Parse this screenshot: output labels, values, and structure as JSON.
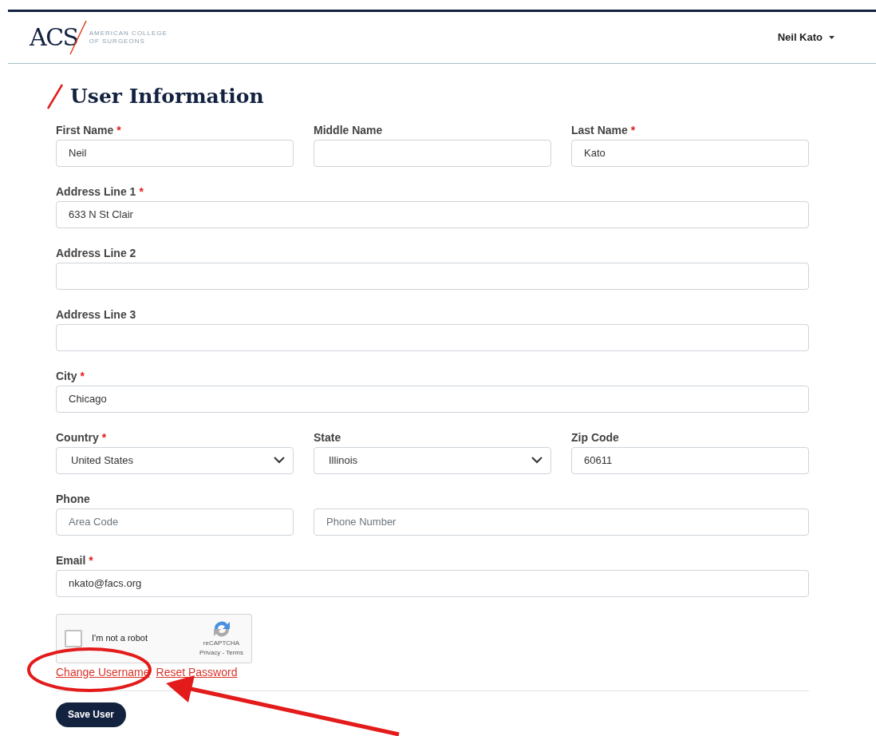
{
  "header": {
    "logo_mark": "ACS",
    "logo_text": [
      "AMERICAN COLLEGE",
      "OF SURGEONS"
    ],
    "user_menu": "Neil Kato"
  },
  "page_title": "User Information",
  "rows": [
    {
      "fields": [
        {
          "label": "First Name",
          "required_mark": "*",
          "kind": "text",
          "value": "Neil"
        },
        {
          "label": "Middle Name",
          "kind": "text"
        },
        {
          "label": "Last Name",
          "required_mark": "*",
          "kind": "text",
          "value": "Kato"
        }
      ]
    },
    {
      "fields": [
        {
          "label": "Address Line 1",
          "required_mark": "*",
          "kind": "text",
          "value": "633 N St Clair"
        }
      ]
    },
    {
      "fields": [
        {
          "label": "Address Line 2",
          "kind": "text"
        }
      ]
    },
    {
      "fields": [
        {
          "label": "Address Line 3",
          "kind": "text"
        }
      ]
    },
    {
      "fields": [
        {
          "label": "City",
          "required_mark": "*",
          "kind": "text",
          "value": "Chicago"
        }
      ]
    },
    {
      "fields": [
        {
          "label": "Country",
          "required_mark": "*",
          "kind": "select",
          "value": "United States"
        },
        {
          "label": "State",
          "kind": "select",
          "value": "Illinois"
        },
        {
          "label": "Zip Code",
          "kind": "text",
          "value": "60611"
        }
      ]
    },
    {
      "label": "Phone",
      "fields": [
        {
          "kind": "text",
          "placeholder": "Area Code"
        },
        {
          "kind": "text",
          "placeholder": "Phone Number"
        }
      ]
    },
    {
      "fields": [
        {
          "label": "Email",
          "required_mark": "*",
          "kind": "text",
          "value": "nkato@facs.org"
        }
      ]
    }
  ],
  "captcha": {
    "label": "I'm not a robot",
    "checked": false,
    "brand": "reCAPTCHA",
    "links": "Privacy - Terms"
  },
  "links": [
    "Change Username",
    "Reset Password"
  ],
  "save_button": "Save User"
}
